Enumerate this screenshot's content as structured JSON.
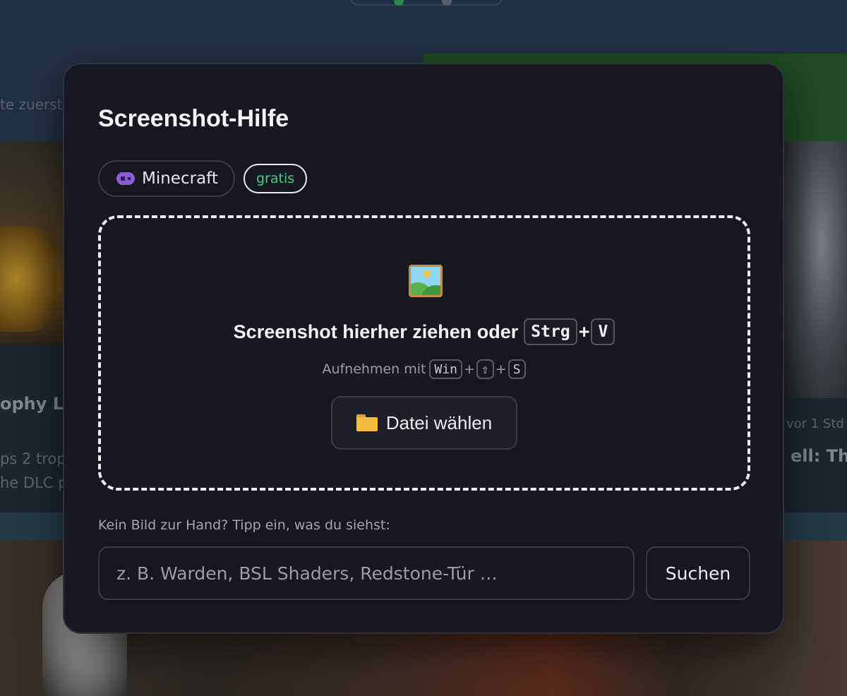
{
  "background": {
    "sort_hint": "te zuerst",
    "left_card": {
      "title": "ophy Lis",
      "desc_line1": "ps 2 trop",
      "desc_line2": "he DLC p"
    },
    "right_card": {
      "time": "vor 1 Std",
      "title": "ell: The r"
    }
  },
  "modal": {
    "title": "Screenshot-Hilfe",
    "game_chip": {
      "icon": "gamepad-icon",
      "label": "Minecraft"
    },
    "price_chip": {
      "label": "gratis",
      "color": "#3ecf8e"
    },
    "dropzone": {
      "icon": "framed-picture-icon",
      "headline": "Screenshot hierher ziehen oder",
      "paste_keys": [
        "Strg",
        "V"
      ],
      "hint": "Aufnehmen mit",
      "capture_keys": [
        "Win",
        "⇧",
        "S"
      ],
      "plus": "+",
      "file_button": {
        "icon": "folder-icon",
        "label": "Datei wählen"
      }
    },
    "manual": {
      "label": "Kein Bild zur Hand? Tipp ein, was du siehst:",
      "placeholder": "z. B. Warden, BSL Shaders, Redstone-Tür …",
      "value": "",
      "search_label": "Suchen"
    }
  }
}
